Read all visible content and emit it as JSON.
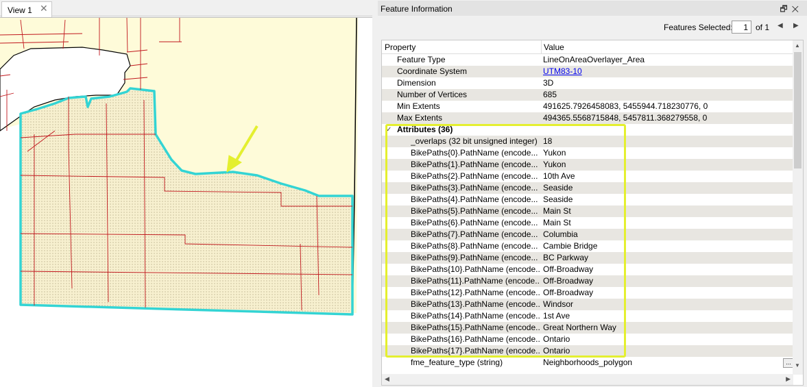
{
  "view": {
    "tab_label": "View 1",
    "tab_close": "✕"
  },
  "panel": {
    "title": "Feature Information",
    "title_icons": "🗗✕"
  },
  "selection": {
    "label": "Features Selected:",
    "value": "1",
    "of": "of 1",
    "prev": "◀",
    "next": "▶"
  },
  "grid": {
    "col_property": "Property",
    "col_value": "Value",
    "rows": [
      {
        "prop": "Feature Type",
        "val": "LineOnAreaOverlayer_Area"
      },
      {
        "prop": "Coordinate System",
        "val": "UTM83-10"
      },
      {
        "prop": "Dimension",
        "val": "3D"
      },
      {
        "prop": "Number of Vertices",
        "val": "685"
      },
      {
        "prop": "Min Extents",
        "val": "491625.7926458083, 5455944.718230776, 0"
      },
      {
        "prop": "Max Extents",
        "val": "494365.5568715848, 5457811.368279558, 0"
      }
    ],
    "group_label": "Attributes (36)",
    "group_chevron": "✓",
    "attributes": [
      {
        "prop": "_overlaps (32 bit unsigned integer)",
        "val": "18"
      },
      {
        "prop": "BikePaths{0}.PathName (encode...",
        "val": "Yukon"
      },
      {
        "prop": "BikePaths{1}.PathName (encode...",
        "val": "Yukon"
      },
      {
        "prop": "BikePaths{2}.PathName (encode...",
        "val": "10th Ave"
      },
      {
        "prop": "BikePaths{3}.PathName (encode...",
        "val": "Seaside"
      },
      {
        "prop": "BikePaths{4}.PathName (encode...",
        "val": "Seaside"
      },
      {
        "prop": "BikePaths{5}.PathName (encode...",
        "val": "Main St"
      },
      {
        "prop": "BikePaths{6}.PathName (encode...",
        "val": "Main St"
      },
      {
        "prop": "BikePaths{7}.PathName (encode...",
        "val": "Columbia"
      },
      {
        "prop": "BikePaths{8}.PathName (encode...",
        "val": "Cambie Bridge"
      },
      {
        "prop": "BikePaths{9}.PathName (encode...",
        "val": "BC Parkway"
      },
      {
        "prop": "BikePaths{10}.PathName (encode...",
        "val": "Off-Broadway"
      },
      {
        "prop": "BikePaths{11}.PathName (encode...",
        "val": "Off-Broadway"
      },
      {
        "prop": "BikePaths{12}.PathName (encode...",
        "val": "Off-Broadway"
      },
      {
        "prop": "BikePaths{13}.PathName (encode...",
        "val": "Windsor"
      },
      {
        "prop": "BikePaths{14}.PathName (encode...",
        "val": "1st Ave"
      },
      {
        "prop": "BikePaths{15}.PathName (encode...",
        "val": "Great Northern Way"
      },
      {
        "prop": "BikePaths{16}.PathName (encode...",
        "val": "Ontario"
      },
      {
        "prop": "BikePaths{17}.PathName (encode...",
        "val": "Ontario"
      },
      {
        "prop": "fme_feature_type (string)",
        "val": "Neighborhoods_polygon"
      }
    ],
    "ellipsis": "..."
  },
  "colors": {
    "map_fill": "#fefbd9",
    "road": "#c0161c",
    "selection_outline": "#33d4d4",
    "highlight": "#e4ef2f",
    "row_alt": "#e8e6e1"
  }
}
